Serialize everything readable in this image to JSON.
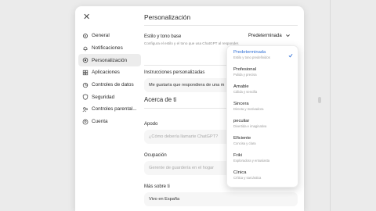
{
  "nav": {
    "close_label": "✕",
    "items": [
      {
        "label": "General",
        "icon": "gear-icon"
      },
      {
        "label": "Notificaciones",
        "icon": "bell-icon"
      },
      {
        "label": "Personalización",
        "icon": "personalization-icon",
        "active": true
      },
      {
        "label": "Aplicaciones",
        "icon": "apps-icon"
      },
      {
        "label": "Controles de datos",
        "icon": "data-controls-icon"
      },
      {
        "label": "Seguridad",
        "icon": "shield-icon"
      },
      {
        "label": "Controles parental...",
        "icon": "parental-icon"
      },
      {
        "label": "Cuenta",
        "icon": "account-icon"
      }
    ]
  },
  "main": {
    "title": "Personalización",
    "style": {
      "label": "Estilo y tono base",
      "description": "Configura el estilo y el tono que usa ChatGPT al responder.",
      "selected": "Predeterminada"
    },
    "custom_instructions": {
      "label": "Instrucciones personalizadas",
      "value": "Me gustaría que respondiera de una m"
    },
    "about_section": "Acerca de ti",
    "nickname": {
      "label": "Apodo",
      "placeholder": "¿Cómo debería llamarte ChatGPT?"
    },
    "occupation": {
      "label": "Ocupación",
      "placeholder": "Gerente de guardería en el hogar"
    },
    "more": {
      "label": "Más sobre ti",
      "value": "Vivo en España"
    }
  },
  "dropdown": {
    "options": [
      {
        "label": "Predeterminada",
        "desc": "Estilo y tono predefinidos",
        "selected": true
      },
      {
        "label": "Profesional",
        "desc": "Pulida y precisa"
      },
      {
        "label": "Amable",
        "desc": "Cálida y sencilla"
      },
      {
        "label": "Sincera",
        "desc": "Directa y motivadora"
      },
      {
        "label": "peculiar",
        "desc": "Divertida e imaginativa"
      },
      {
        "label": "Eficiente",
        "desc": "Concisa y clara"
      },
      {
        "label": "Friki",
        "desc": "Exploradora y entusiasta"
      },
      {
        "label": "Cínica",
        "desc": "Crítica y sarcástica"
      }
    ]
  },
  "colors": {
    "accent": "#2f6fd6",
    "active_bg": "#ececec"
  }
}
